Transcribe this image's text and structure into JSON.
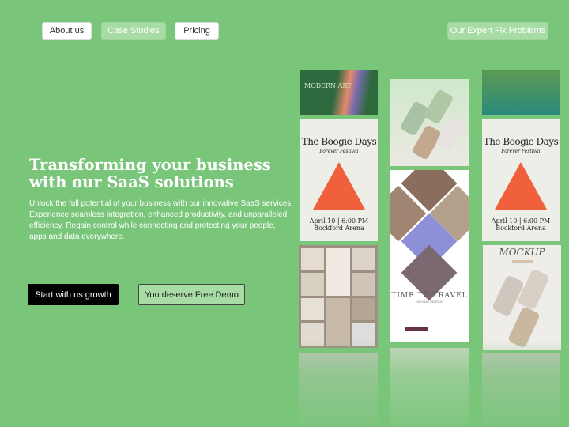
{
  "nav": {
    "about": "About us",
    "case": "Case Studies",
    "pricing": "Pricing",
    "expert": "Our Expert Fix Problems"
  },
  "hero": {
    "title": "Transforming your business with our SaaS solutions",
    "description": "Unlock the full potential of your business with our innovative SaaS services. Experience seamless integration, enhanced productivity, and unparalleled efficiency. Regain control while connecting and protecting your people, apps and data everywhere.",
    "primary_cta": "Start with us growth",
    "secondary_cta": "You deserve Free Demo"
  },
  "gallery": {
    "modern_art": "MODERN ART",
    "poster": {
      "title": "The Boogie Days",
      "subtitle": "Forever Festival",
      "date": "April 10 | 6:00 PM",
      "venue": "Bockford Arena"
    },
    "travel": {
      "title": "TIME TO TRAVEL",
      "subtitle": "HOLIDAY SEASON"
    },
    "mockup": "MOCKUP"
  },
  "colors": {
    "background": "#79c57a",
    "accent": "#a8dca5",
    "primary_button": "#000000"
  }
}
